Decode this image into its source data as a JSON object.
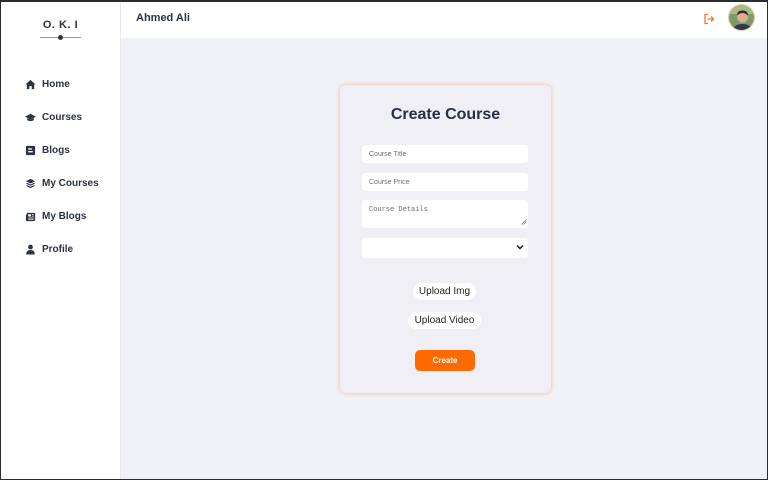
{
  "brand": {
    "logo": "O. K. I",
    "accent": "#ff6a00"
  },
  "sidebar": {
    "items": [
      {
        "label": "Home",
        "icon": "home-icon"
      },
      {
        "label": "Courses",
        "icon": "graduation-cap-icon"
      },
      {
        "label": "Blogs",
        "icon": "blog-icon"
      },
      {
        "label": "My Courses",
        "icon": "layers-icon"
      },
      {
        "label": "My Blogs",
        "icon": "newspaper-icon"
      },
      {
        "label": "Profile",
        "icon": "user-icon"
      }
    ]
  },
  "header": {
    "username": "Ahmed Ali",
    "logout_icon": "logout-icon",
    "avatar": "user-avatar"
  },
  "form": {
    "title": "Create Course",
    "course_title_placeholder": "Course Title",
    "course_price_placeholder": "Course Price",
    "course_details_placeholder": "Course Details",
    "category_selected": "",
    "upload_img_label": "Upload Img",
    "upload_video_label": "Upload Video",
    "create_label": "Create"
  }
}
